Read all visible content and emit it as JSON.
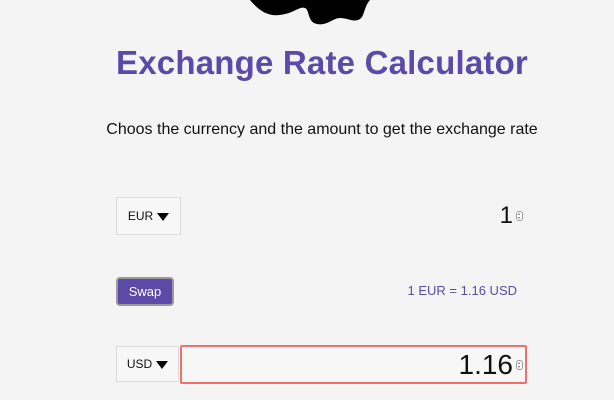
{
  "header": {
    "logo_icon": "money-blob-icon",
    "title": "Exchange Rate Calculator",
    "subtitle": "Choos the currency and the amount to get the exchange rate"
  },
  "converter": {
    "currency_one": "EUR",
    "amount_one": "1",
    "swap_label": "Swap",
    "rate_text": "1 EUR = 1.16 USD",
    "currency_two": "USD",
    "amount_two": "1.16"
  },
  "colors": {
    "accent": "#5b4aa8",
    "background": "#f4f4f4",
    "focus_border": "#f07070"
  }
}
